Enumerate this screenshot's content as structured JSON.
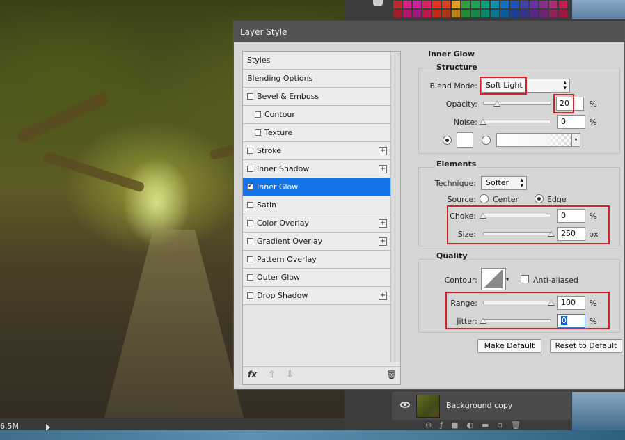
{
  "background": {
    "status_text": "6.5M"
  },
  "layers_panel": {
    "layer_name": "Background copy"
  },
  "swatch_colors": [
    "#c0282e",
    "#d8208c",
    "#d020a0",
    "#e02060",
    "#e83020",
    "#d94020",
    "#e0a020",
    "#30a040",
    "#20a058",
    "#10a080",
    "#1090b0",
    "#1070c0",
    "#2050c0",
    "#4040b0",
    "#6a30a8",
    "#8a2a90",
    "#b02a70",
    "#c02050",
    "#a01e24",
    "#b0186c",
    "#a0187e",
    "#b8184a",
    "#c02818",
    "#b03418",
    "#b88418",
    "#248a34",
    "#188846",
    "#0c8868",
    "#0c7690",
    "#0c5a9c",
    "#18409c",
    "#34348c",
    "#562888",
    "#702274",
    "#90225a",
    "#9c1a40"
  ],
  "dialog": {
    "title": "Layer Style",
    "styles_list": [
      {
        "label": "Styles",
        "checkbox": false,
        "checked": false,
        "plus": false,
        "indent": false,
        "selected": false
      },
      {
        "label": "Blending Options",
        "checkbox": false,
        "checked": false,
        "plus": false,
        "indent": false,
        "selected": false
      },
      {
        "label": "Bevel & Emboss",
        "checkbox": true,
        "checked": false,
        "plus": false,
        "indent": false,
        "selected": false
      },
      {
        "label": "Contour",
        "checkbox": true,
        "checked": false,
        "plus": false,
        "indent": true,
        "selected": false
      },
      {
        "label": "Texture",
        "checkbox": true,
        "checked": false,
        "plus": false,
        "indent": true,
        "selected": false
      },
      {
        "label": "Stroke",
        "checkbox": true,
        "checked": false,
        "plus": true,
        "indent": false,
        "selected": false
      },
      {
        "label": "Inner Shadow",
        "checkbox": true,
        "checked": false,
        "plus": true,
        "indent": false,
        "selected": false
      },
      {
        "label": "Inner Glow",
        "checkbox": true,
        "checked": true,
        "plus": false,
        "indent": false,
        "selected": true
      },
      {
        "label": "Satin",
        "checkbox": true,
        "checked": false,
        "plus": false,
        "indent": false,
        "selected": false
      },
      {
        "label": "Color Overlay",
        "checkbox": true,
        "checked": false,
        "plus": true,
        "indent": false,
        "selected": false
      },
      {
        "label": "Gradient Overlay",
        "checkbox": true,
        "checked": false,
        "plus": true,
        "indent": false,
        "selected": false
      },
      {
        "label": "Pattern Overlay",
        "checkbox": true,
        "checked": false,
        "plus": false,
        "indent": false,
        "selected": false
      },
      {
        "label": "Outer Glow",
        "checkbox": true,
        "checked": false,
        "plus": false,
        "indent": false,
        "selected": false
      },
      {
        "label": "Drop Shadow",
        "checkbox": true,
        "checked": false,
        "plus": true,
        "indent": false,
        "selected": false
      }
    ],
    "footer": {
      "fx_icon": "fx-icon",
      "fx_label": "fx"
    },
    "inner_glow": {
      "heading": "Inner Glow",
      "structure": {
        "heading": "Structure",
        "blend_mode_label": "Blend Mode:",
        "blend_mode_value": "Soft Light",
        "opacity_label": "Opacity:",
        "opacity_value": "20",
        "opacity_unit": "%",
        "opacity_level": 0.2,
        "noise_label": "Noise:",
        "noise_value": "0",
        "noise_unit": "%",
        "noise_level": 0
      },
      "elements": {
        "heading": "Elements",
        "technique_label": "Technique:",
        "technique_value": "Softer",
        "source_label": "Source:",
        "source_center_label": "Center",
        "source_edge_label": "Edge",
        "source_selected": "Edge",
        "choke_label": "Choke:",
        "choke_value": "0",
        "choke_unit": "%",
        "choke_level": 0,
        "size_label": "Size:",
        "size_value": "250",
        "size_unit": "px",
        "size_level": 1.0
      },
      "quality": {
        "heading": "Quality",
        "contour_label": "Contour:",
        "anti_aliased_label": "Anti-aliased",
        "anti_aliased_checked": false,
        "range_label": "Range:",
        "range_value": "100",
        "range_unit": "%",
        "range_level": 1.0,
        "jitter_label": "Jitter:",
        "jitter_value": "0",
        "jitter_unit": "%",
        "jitter_level": 0
      },
      "make_default_label": "Make Default",
      "reset_default_label": "Reset to Default"
    }
  }
}
